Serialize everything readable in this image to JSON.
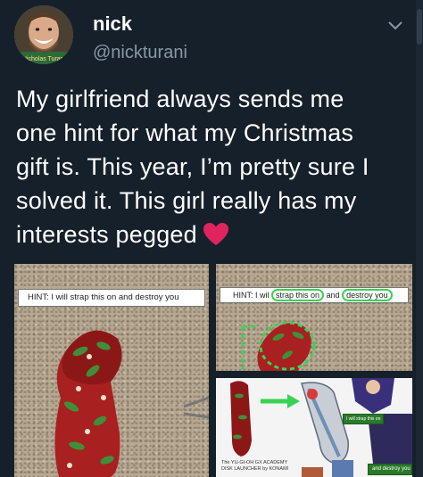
{
  "user": {
    "name": "nick",
    "handle": "@nickturani",
    "avatar_badge": "Nicholas Turani"
  },
  "tweet": {
    "lines": [
      "My girlfriend always sends me",
      "one hint for what my Christmas",
      "gift is. This year, I’m pretty sure I",
      "solved it. This girl really has my",
      "interests pegged"
    ],
    "heart_emoji": "heart-icon"
  },
  "media": {
    "panel1": {
      "hint": "HINT: I will strap this on and destroy you"
    },
    "panel2": {
      "hint_prefix": "HINT: I wil",
      "hint_circle1": "strap this on",
      "hint_and": "and",
      "hint_circle2": "destroy you"
    },
    "panel3": {
      "tag1": "I will strap this on",
      "tag2": "and destroy you",
      "caption_line1": "The YU-GI-OH GX ACADEMY",
      "caption_line2": "DISK LAUNCHER by KONAMI"
    }
  },
  "colors": {
    "background": "#15202b",
    "secondary_text": "#8899a6",
    "heart": "#e0245e",
    "highlight": "#39d353"
  }
}
